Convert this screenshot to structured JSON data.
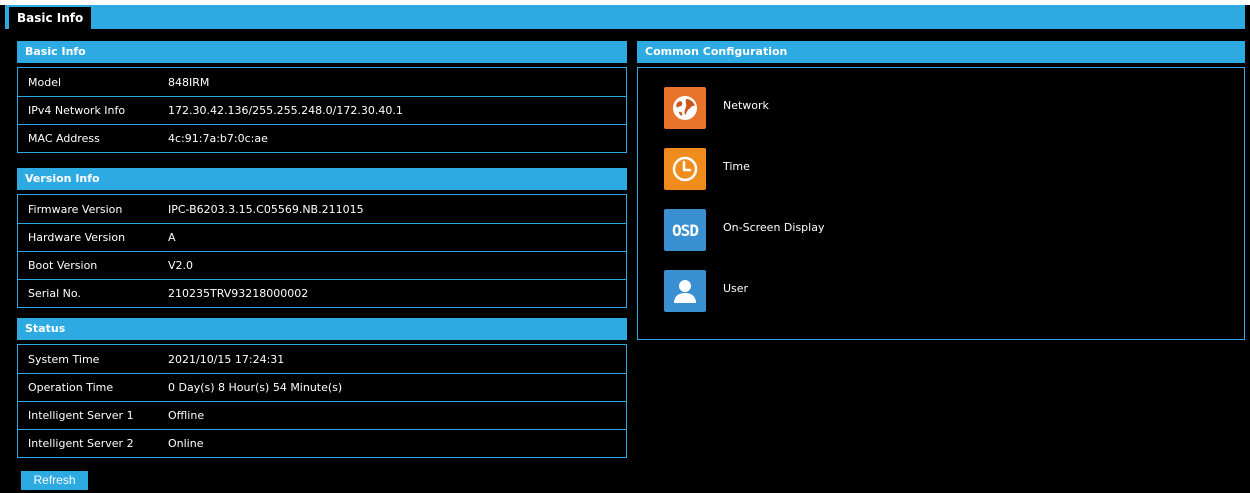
{
  "tabs": {
    "active": "Basic Info"
  },
  "basic_info": {
    "title": "Basic Info",
    "rows": [
      {
        "label": "Model",
        "value": "848IRM"
      },
      {
        "label": "IPv4 Network Info",
        "value": "172.30.42.136/255.255.248.0/172.30.40.1"
      },
      {
        "label": "MAC Address",
        "value": "4c:91:7a:b7:0c:ae"
      }
    ]
  },
  "version_info": {
    "title": "Version Info",
    "rows": [
      {
        "label": "Firmware Version",
        "value": "IPC-B6203.3.15.C05569.NB.211015"
      },
      {
        "label": "Hardware Version",
        "value": "A"
      },
      {
        "label": "Boot Version",
        "value": "V2.0"
      },
      {
        "label": "Serial No.",
        "value": "210235TRV93218000002"
      }
    ]
  },
  "status": {
    "title": "Status",
    "rows": [
      {
        "label": "System Time",
        "value": "2021/10/15 17:24:31"
      },
      {
        "label": "Operation Time",
        "value": "0 Day(s) 8 Hour(s) 54 Minute(s)"
      },
      {
        "label": "Intelligent Server 1",
        "value": "Offline"
      },
      {
        "label": "Intelligent Server 2",
        "value": "Online"
      }
    ]
  },
  "common_config": {
    "title": "Common Configuration",
    "items": [
      {
        "label": "Network",
        "icon": "globe-icon",
        "color": "#e8742a"
      },
      {
        "label": "Time",
        "icon": "clock-icon",
        "color": "#f08c1e"
      },
      {
        "label": "On-Screen Display",
        "icon": "osd-icon",
        "icon_text": "OSD",
        "color": "#3a8fd0"
      },
      {
        "label": "User",
        "icon": "user-icon",
        "color": "#3a8fd0"
      }
    ]
  },
  "refresh_label": "Refresh",
  "colors": {
    "accent": "#2eaae2",
    "background": "#000000"
  }
}
